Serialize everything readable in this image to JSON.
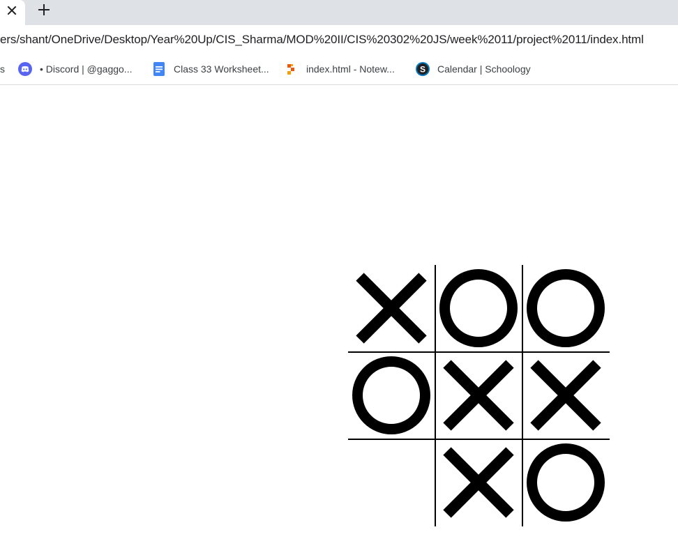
{
  "browser": {
    "address": "ers/shant/OneDrive/Desktop/Year%20Up/CIS_Sharma/MOD%20II/CIS%20302%20JS/week%2011/project%2011/index.html",
    "bookmarks": [
      {
        "label": "s",
        "icon": "bookmark-fragment"
      },
      {
        "label": "• Discord | @gaggo...",
        "icon": "discord-icon"
      },
      {
        "label": "Class 33 Worksheet...",
        "icon": "google-docs-icon"
      },
      {
        "label": "index.html - Notew...",
        "icon": "notewave-icon"
      },
      {
        "label": "Calendar | Schoology",
        "icon": "schoology-icon"
      }
    ]
  },
  "board": {
    "cells": [
      "X",
      "O",
      "O",
      "O",
      "X",
      "X",
      "",
      "X",
      "O"
    ]
  },
  "colors": {
    "tabstrip": "#dee1e6",
    "mark": "#000000",
    "discord": "#5865f2",
    "docs": "#4285f4",
    "notewave": "#e8590c",
    "schoology": "#0677ba"
  }
}
